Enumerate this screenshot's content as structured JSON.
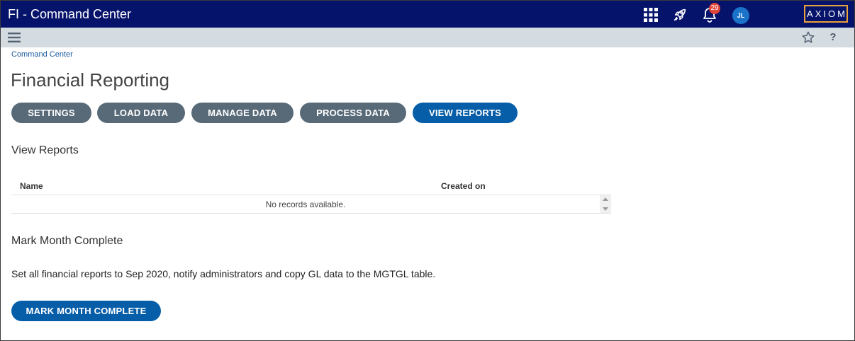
{
  "header": {
    "app_title": "FI - Command Center",
    "notification_count": "29",
    "avatar_initials": "JL",
    "logo_text": "AXIOM",
    "icons": [
      "apps-grid-icon",
      "rocket-icon",
      "bell-icon"
    ]
  },
  "subbar": {
    "icons": [
      "hamburger-menu-icon",
      "star-icon",
      "help-icon"
    ],
    "help_glyph": "?"
  },
  "breadcrumb": "Command Center",
  "page_title": "Financial Reporting",
  "nav_buttons": [
    {
      "label": "SETTINGS",
      "active": false
    },
    {
      "label": "LOAD DATA",
      "active": false
    },
    {
      "label": "MANAGE DATA",
      "active": false
    },
    {
      "label": "PROCESS DATA",
      "active": false
    },
    {
      "label": "VIEW REPORTS",
      "active": true
    }
  ],
  "view_reports": {
    "title": "View Reports",
    "columns": [
      "Name",
      "Created on"
    ],
    "empty_message": "No records available."
  },
  "mark_month": {
    "title": "Mark Month Complete",
    "description": "Set all financial reports to Sep 2020, notify administrators and copy GL data to the MGTGL table.",
    "button_label": "MARK MONTH COMPLETE"
  },
  "colors": {
    "topbar": "#06136b",
    "subbar": "#d4dbe1",
    "button_grey": "#586a78",
    "button_blue": "#075ea8",
    "logo_border": "#e8a33b",
    "badge": "#e0453a"
  }
}
